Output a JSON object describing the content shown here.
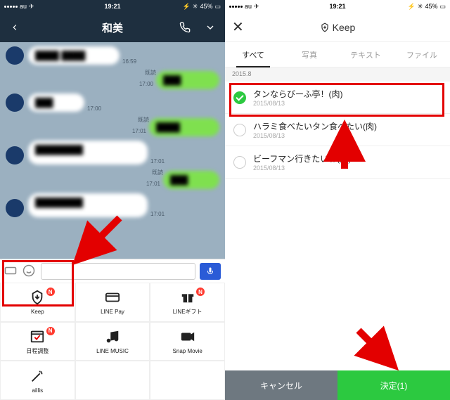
{
  "statusbar": {
    "carrier": "au",
    "time": "19:21",
    "battery": "45%"
  },
  "left": {
    "title": "和美",
    "messages": [
      {
        "dir": "in",
        "time": "16:59"
      },
      {
        "dir": "out",
        "time": "17:00",
        "read": "既読"
      },
      {
        "dir": "in",
        "time": "17:00"
      },
      {
        "dir": "out",
        "time": "17:01",
        "read": "既読"
      },
      {
        "dir": "in",
        "time": "17:01"
      },
      {
        "dir": "out",
        "time": "17:01",
        "read": "既読"
      },
      {
        "dir": "in",
        "time": "17:01"
      }
    ],
    "grid": [
      {
        "label": "Keep",
        "badge": "N"
      },
      {
        "label": "LINE Pay"
      },
      {
        "label": "LINEギフト",
        "badge": "N"
      },
      {
        "label": "日程調整",
        "badge": "N"
      },
      {
        "label": "LINE MUSIC"
      },
      {
        "label": "Snap Movie"
      },
      {
        "label": "aillis"
      }
    ]
  },
  "right": {
    "title": "Keep",
    "tabs": [
      "すべて",
      "写真",
      "テキスト",
      "ファイル"
    ],
    "section": "2015.8",
    "items": [
      {
        "title": "タンならびーふ亭！(肉)",
        "date": "2015/08/13",
        "checked": true
      },
      {
        "title": "ハラミ食べたいタン食べたい(肉)",
        "date": "2015/08/13",
        "checked": false
      },
      {
        "title": "ビーフマン行きたいね(肉)",
        "date": "2015/08/13",
        "checked": false
      }
    ],
    "cancel": "キャンセル",
    "ok": "決定(1)"
  }
}
